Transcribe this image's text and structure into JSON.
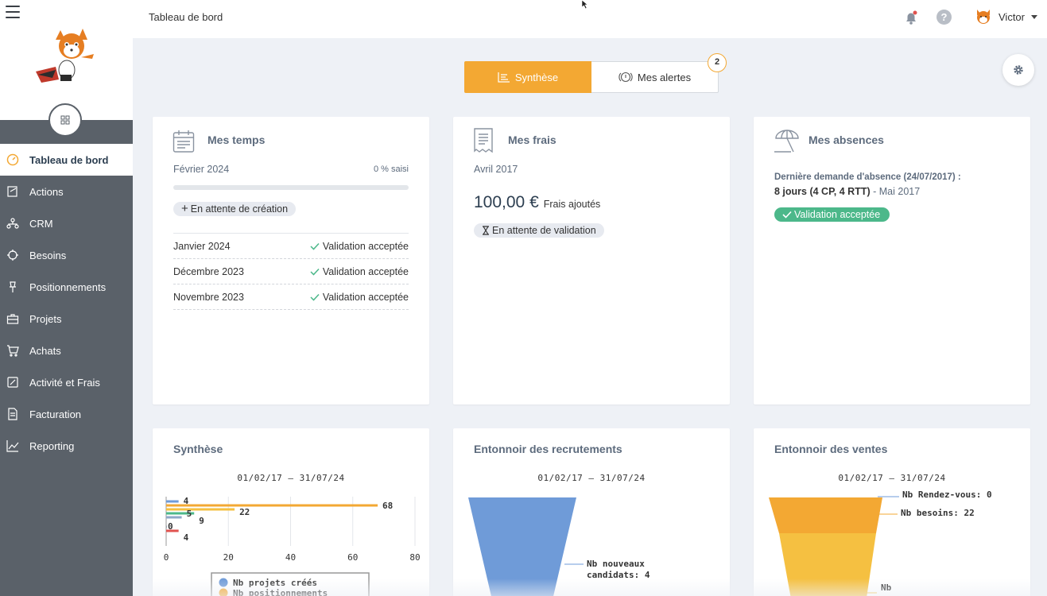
{
  "topbar": {
    "title": "Tableau de bord",
    "user_name": "Victor",
    "help_label": "?"
  },
  "sidebar": {
    "items": [
      {
        "label": "Tableau de bord",
        "icon": "dashboard-icon",
        "active": true
      },
      {
        "label": "Actions",
        "icon": "actions-icon"
      },
      {
        "label": "CRM",
        "icon": "crm-icon"
      },
      {
        "label": "Besoins",
        "icon": "target-icon"
      },
      {
        "label": "Positionnements",
        "icon": "pin-icon"
      },
      {
        "label": "Projets",
        "icon": "briefcase-icon"
      },
      {
        "label": "Achats",
        "icon": "cart-icon"
      },
      {
        "label": "Activité et Frais",
        "icon": "edit-icon"
      },
      {
        "label": "Facturation",
        "icon": "invoice-icon"
      },
      {
        "label": "Reporting",
        "icon": "chart-icon"
      }
    ]
  },
  "tabs": {
    "synthese": "Synthèse",
    "alertes": "Mes alertes",
    "alertes_count": "2"
  },
  "temps": {
    "title": "Mes temps",
    "period": "Février 2024",
    "saisi": "0 % saisi",
    "status_pill": "En attente de création",
    "rows": [
      {
        "month": "Janvier 2024",
        "status": "Validation acceptée"
      },
      {
        "month": "Décembre 2023",
        "status": "Validation acceptée"
      },
      {
        "month": "Novembre 2023",
        "status": "Validation acceptée"
      }
    ]
  },
  "frais": {
    "title": "Mes frais",
    "period": "Avril 2017",
    "amount": "100,00 €",
    "amount_label": "Frais ajoutés",
    "status_pill": "En attente de validation"
  },
  "absences": {
    "title": "Mes absences",
    "last_request": "Dernière demande d'absence (24/07/2017) :",
    "days": "8 jours (4 CP, 4 RTT)",
    "period": " - Mai 2017",
    "status_pill": "Validation acceptée"
  },
  "colors": {
    "accent": "#f3a833",
    "sidebar": "#5a6169",
    "success": "#4cb88a",
    "blue": "#6f9bd8",
    "yellow": "#f5c041"
  },
  "synthese_chart": {
    "title": "Synthèse",
    "date_range": "01/02/17 – 31/07/24"
  },
  "recrutements": {
    "title": "Entonnoir des recrutements",
    "date_range": "01/02/17 – 31/07/24"
  },
  "ventes": {
    "title": "Entonnoir des ventes",
    "date_range": "01/02/17 – 31/07/24"
  },
  "chart_data": [
    {
      "type": "bar",
      "orientation": "horizontal",
      "title": "Synthèse",
      "subtitle": "01/02/17 – 31/07/24",
      "xlim": [
        0,
        80
      ],
      "xticks": [
        "0",
        "20",
        "40",
        "60",
        "80"
      ],
      "bars": [
        {
          "value": 4,
          "color": "#6f9bd8"
        },
        {
          "value": 68,
          "color": "#f3a833"
        },
        {
          "value": 22,
          "color": "#f5c041"
        },
        {
          "value": 9,
          "color": "#4cb88a"
        },
        {
          "value": 5,
          "color": "#8fa8c8"
        },
        {
          "value": 0,
          "color": "#34495e"
        },
        {
          "value": 4,
          "color": "#e0524f"
        }
      ],
      "legend": [
        "Nb projets créés",
        "Nb positionnements"
      ],
      "legend_colors": [
        "#6f9bd8",
        "#f3a833"
      ]
    },
    {
      "type": "funnel",
      "title": "Entonnoir des recrutements",
      "subtitle": "01/02/17 – 31/07/24",
      "stages": [
        {
          "label": "Nb nouveaux candidats: 4",
          "value": 4,
          "color": "#6f9bd8"
        }
      ]
    },
    {
      "type": "funnel",
      "title": "Entonnoir des ventes",
      "subtitle": "01/02/17 – 31/07/24",
      "stages": [
        {
          "label": "Nb Rendez-vous: 0",
          "value": 0
        },
        {
          "label": "Nb besoins: 22",
          "value": 22,
          "color": "#f3a833"
        },
        {
          "label": "Nb",
          "color": "#f5c041"
        }
      ]
    }
  ]
}
